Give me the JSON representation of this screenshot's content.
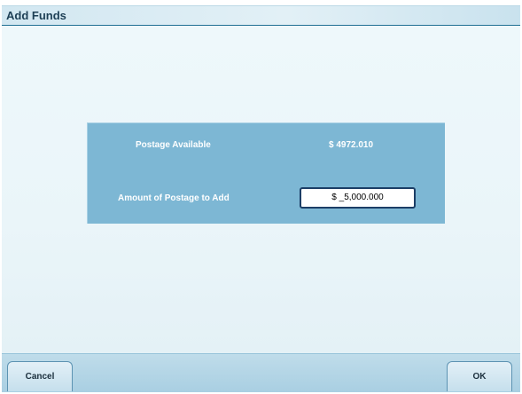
{
  "window": {
    "title": "Add Funds"
  },
  "panel": {
    "available_label": "Postage Available",
    "available_value": "$ 4972.010",
    "add_label": "Amount of Postage to Add",
    "add_value": "$ _5,000.000"
  },
  "buttons": {
    "cancel_label": "Cancel",
    "ok_label": "OK"
  },
  "colors": {
    "panel_background": "#7db7d4",
    "title_underline": "#1f6f93",
    "content_background": "#eef8fb",
    "input_border": "#1c3e66"
  }
}
